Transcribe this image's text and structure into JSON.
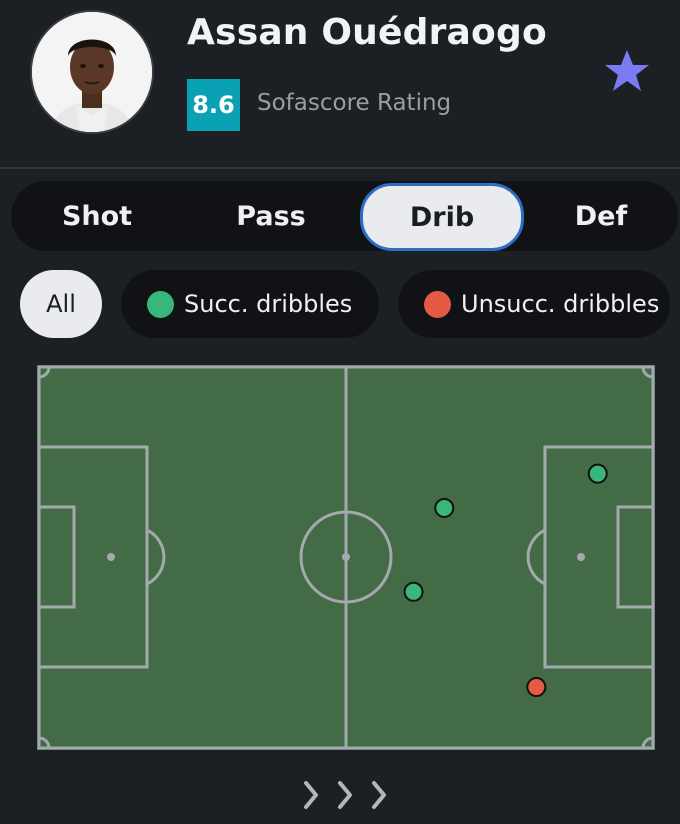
{
  "player": {
    "name": "Assan Ouédraogo",
    "rating": "8.6",
    "rating_label": "Sofascore Rating"
  },
  "colors": {
    "rating": "#0aa1b5",
    "star": "#7b7cf5",
    "pitch": "#436b46",
    "succ": "#39b77a",
    "unsucc": "#e55a45",
    "active_tab_border": "#2c6ec4"
  },
  "tabs": [
    {
      "label": "Shot"
    },
    {
      "label": "Pass"
    },
    {
      "label": "Drib",
      "active": true
    },
    {
      "label": "Def"
    }
  ],
  "filters": [
    {
      "label": "All",
      "active": true
    },
    {
      "label": "Succ. dribbles",
      "dot": "green"
    },
    {
      "label": "Unsucc. dribbles",
      "dot": "red"
    }
  ],
  "dribbles": [
    {
      "result": "success",
      "x": 91,
      "y": 28
    },
    {
      "result": "success",
      "x": 66,
      "y": 37
    },
    {
      "result": "success",
      "x": 61,
      "y": 59
    },
    {
      "result": "fail",
      "x": 81,
      "y": 84
    }
  ],
  "icons": {
    "favorite": "star-icon",
    "next": "chevrons-right-icon"
  }
}
